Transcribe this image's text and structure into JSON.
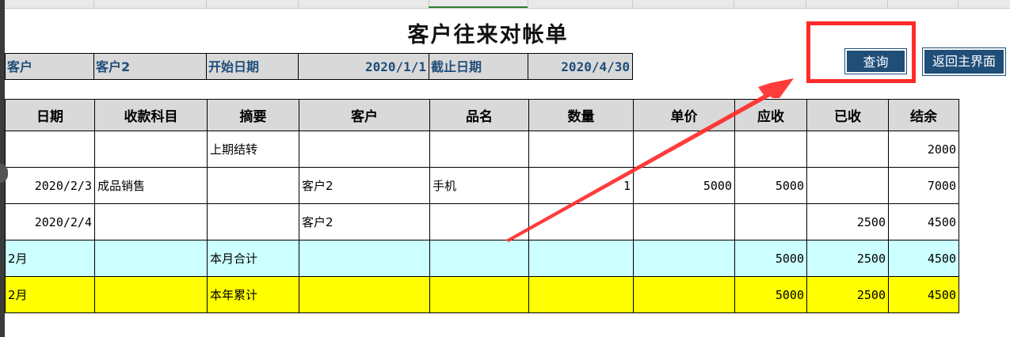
{
  "title": "客户往来对帐单",
  "info": {
    "customer_label": "客户",
    "customer_value": "客户2",
    "start_label": "开始日期",
    "start_value": "2020/1/1",
    "end_label": "截止日期",
    "end_value": "2020/4/30"
  },
  "buttons": {
    "query": "查询",
    "back": "返回主界面"
  },
  "table": {
    "headers": [
      "日期",
      "收款科目",
      "摘要",
      "客户",
      "品名",
      "数量",
      "单价",
      "应收",
      "已收",
      "结余"
    ],
    "rows": [
      [
        "",
        "",
        "上期结转",
        "",
        "",
        "",
        "",
        "",
        "",
        "2000"
      ],
      [
        "2020/2/3",
        "成品销售",
        "",
        "客户2",
        "手机",
        "1",
        "5000",
        "5000",
        "",
        "7000"
      ],
      [
        "2020/2/4",
        "",
        "",
        "客户2",
        "",
        "",
        "",
        "",
        "2500",
        "4500"
      ],
      [
        "2月",
        "",
        "本月合计",
        "",
        "",
        "",
        "",
        "5000",
        "2500",
        "4500"
      ],
      [
        "2月",
        "",
        "本年累计",
        "",
        "",
        "",
        "",
        "5000",
        "2500",
        "4500"
      ]
    ]
  },
  "colors": {
    "header_bg": "#d9d9d9",
    "label_text": "#1f4e79",
    "month_total_bg": "#ccffff",
    "year_total_bg": "#ffff00",
    "button_bg": "#1f4e79",
    "highlight_red": "#ff2b2b"
  }
}
